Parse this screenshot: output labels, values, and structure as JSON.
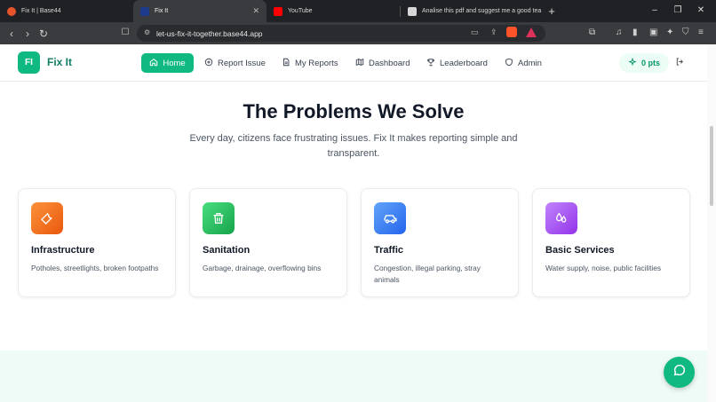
{
  "browser": {
    "tabs": [
      {
        "title": "Fix It | Base44",
        "active": false,
        "favicon_color": "#e8542a"
      },
      {
        "title": "Fix It",
        "active": true,
        "favicon_color": "#1e3a8a"
      },
      {
        "title": "YouTube",
        "active": false,
        "favicon_color": "#ff0000"
      },
      {
        "title": "Analise this pdf and suggest me a good tea",
        "active": false,
        "favicon_color": "#d6d6d6"
      }
    ],
    "url": "let-us-fix-it-together.base44.app"
  },
  "header": {
    "logo_initials": "FI",
    "app_name": "Fix It",
    "nav": [
      {
        "label": "Home",
        "icon": "home-icon",
        "active": true
      },
      {
        "label": "Report Issue",
        "icon": "plus-circle-icon",
        "active": false
      },
      {
        "label": "My Reports",
        "icon": "file-icon",
        "active": false
      },
      {
        "label": "Dashboard",
        "icon": "map-icon",
        "active": false
      },
      {
        "label": "Leaderboard",
        "icon": "trophy-icon",
        "active": false
      },
      {
        "label": "Admin",
        "icon": "shield-icon",
        "active": false
      }
    ],
    "points": "0 pts"
  },
  "main": {
    "title": "The Problems We Solve",
    "subtitle": "Every day, citizens face frustrating issues. Fix It makes reporting simple and transparent.",
    "cards": [
      {
        "title": "Infrastructure",
        "description": "Potholes, streetlights, broken footpaths",
        "icon": "wrench-icon",
        "color_from": "#fb923c",
        "color_to": "#ea580c"
      },
      {
        "title": "Sanitation",
        "description": "Garbage, drainage, overflowing bins",
        "icon": "trash-icon",
        "color_from": "#4ade80",
        "color_to": "#16a34a"
      },
      {
        "title": "Traffic",
        "description": "Congestion, illegal parking, stray animals",
        "icon": "car-icon",
        "color_from": "#60a5fa",
        "color_to": "#2563eb"
      },
      {
        "title": "Basic Services",
        "description": "Water supply, noise, public facilities",
        "icon": "droplets-icon",
        "color_from": "#c084fc",
        "color_to": "#9333ea"
      }
    ]
  },
  "colors": {
    "brand": "#10b981",
    "brand_dark": "#0f7d63"
  }
}
